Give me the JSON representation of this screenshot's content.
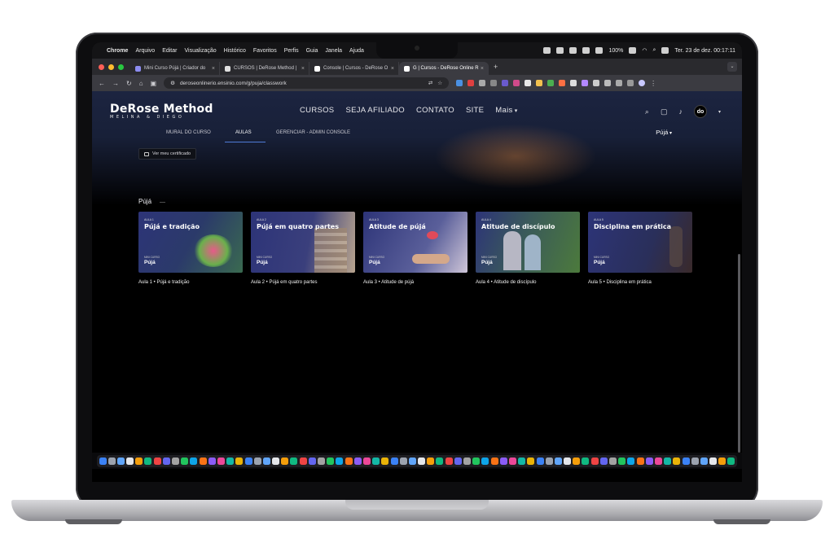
{
  "menubar": {
    "app": "Chrome",
    "items": [
      "Arquivo",
      "Editar",
      "Visualização",
      "Histórico",
      "Favoritos",
      "Perfis",
      "Guia",
      "Janela",
      "Ajuda"
    ],
    "battery": "100%",
    "clock": "Ter. 23 de dez. 00:17:11"
  },
  "browser": {
    "tabs": [
      {
        "label": "Mini Curso Pújá | Criador do"
      },
      {
        "label": "CURSOS | DeRose Method |"
      },
      {
        "label": "Console | Cursos - DeRose O"
      },
      {
        "label": "G | Cursos - DeRose Online R"
      }
    ],
    "url": "deroseonlinerio.ensinio.com/g/puja/classwork"
  },
  "site": {
    "logo_main": "DeRose Method",
    "logo_sub": "MELINA & DIEGO",
    "nav": [
      "CURSOS",
      "SEJA AFILIADO",
      "CONTATO",
      "SITE",
      "Mais"
    ],
    "avatar": "do",
    "subnav": [
      "MURAL DO CURSO",
      "AULAS",
      "GERENCIAR - ADMIN CONSOLE"
    ],
    "course_selector": "Pújá",
    "cert_button": "Ver meu certificado",
    "section_title": "Pújá",
    "cards": [
      {
        "num": "AULA 1",
        "title": "Pújá e tradição",
        "mini": "MINI CURSO",
        "course": "Pújá",
        "caption": "Aula 1 • Pújá e tradição"
      },
      {
        "num": "AULA 2",
        "title": "Pújá em quatro partes",
        "mini": "MINI CURSO",
        "course": "Pújá",
        "caption": "Aula 2 • Pújá em quatro partes"
      },
      {
        "num": "AULA 3",
        "title": "Atitude de pújá",
        "mini": "MINI CURSO",
        "course": "Pújá",
        "caption": "Aula 3 • Atitude de pújá"
      },
      {
        "num": "AULA 4",
        "title": "Atitude de discípulo",
        "mini": "MINI CURSO",
        "course": "Pújá",
        "caption": "Aula 4 • Atitude de discípulo"
      },
      {
        "num": "AULA 5",
        "title": "Disciplina em prática",
        "mini": "MINI CURSO",
        "course": "Pújá",
        "caption": "Aula 5 • Disciplina em prática"
      }
    ]
  },
  "colors": {
    "accent": "#4f7bd8",
    "card_bg": "#2a3270"
  }
}
